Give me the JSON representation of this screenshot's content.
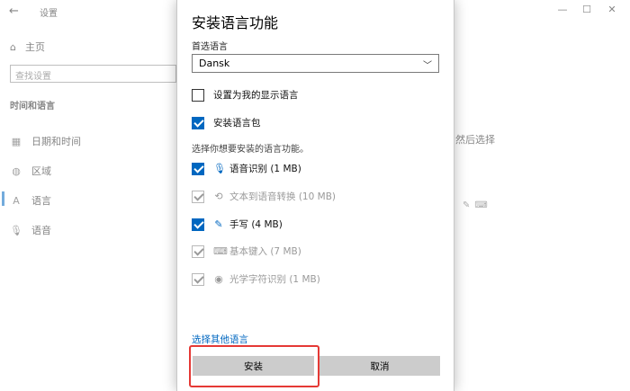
{
  "background": {
    "window_title": "设置",
    "back_glyph": "←",
    "controls": {
      "minimize": "—",
      "maximize": "☐",
      "close": "✕"
    },
    "home_label": "主页",
    "search_placeholder": "查找设置",
    "section_title": "时间和语言",
    "nav": [
      {
        "label": "日期和时间",
        "icon": "calendar-icon",
        "glyph": "▦"
      },
      {
        "label": "区域",
        "icon": "globe-icon",
        "glyph": "◍"
      },
      {
        "label": "语言",
        "icon": "language-icon",
        "glyph": "A"
      },
      {
        "label": "语音",
        "icon": "microphone-icon",
        "glyph": "🎙"
      }
    ],
    "right_text": "然后选择",
    "right_icons": [
      "✎",
      "⌨"
    ]
  },
  "dialog": {
    "title": "安装语言功能",
    "preferred_label": "首选语言",
    "preferred_value": "Dansk",
    "set_display": {
      "label": "设置为我的显示语言",
      "checked": false
    },
    "install_pack": {
      "label": "安装语言包",
      "checked": true
    },
    "choose_label": "选择你想要安装的语言功能。",
    "features": [
      {
        "label": "语音识别 (1 MB)",
        "icon": "microphone-icon",
        "glyph": "🎙",
        "checked": true,
        "enabled": true
      },
      {
        "label": "文本到语音转换 (10 MB)",
        "icon": "text-to-speech-icon",
        "glyph": "⟲",
        "checked": true,
        "enabled": false
      },
      {
        "label": "手写 (4 MB)",
        "icon": "handwriting-icon",
        "glyph": "✎",
        "checked": true,
        "enabled": true
      },
      {
        "label": "基本键入 (7 MB)",
        "icon": "keyboard-icon",
        "glyph": "⌨",
        "checked": true,
        "enabled": false
      },
      {
        "label": "光学字符识别 (1 MB)",
        "icon": "ocr-icon",
        "glyph": "◉",
        "checked": true,
        "enabled": false
      }
    ],
    "more_link": "选择其他语言",
    "install_button": "安装",
    "cancel_button": "取消"
  },
  "colors": {
    "accent": "#0067c0",
    "highlight": "#e53935",
    "button": "#cccccc"
  }
}
